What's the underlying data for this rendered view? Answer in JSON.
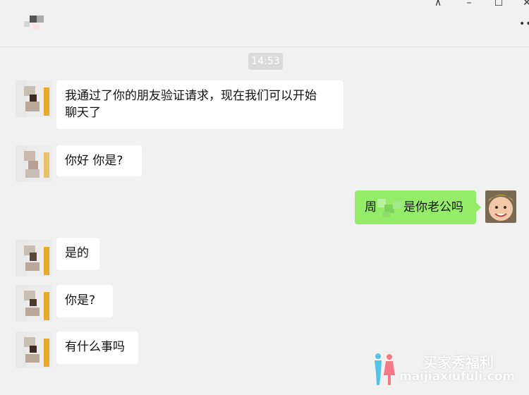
{
  "window": {
    "controls": {
      "pin_icon": "⊼",
      "minimize_icon": "–",
      "maximize_icon": "☐",
      "close_icon": "✕",
      "more_icon": "•••"
    }
  },
  "chat": {
    "timestamp": "14:53",
    "messages": [
      {
        "sender": "other",
        "text": "我通过了你的朋友验证请求，现在我们可以开始\n聊天了"
      },
      {
        "sender": "other",
        "text": "你好 你是?"
      },
      {
        "sender": "me",
        "text_prefix": "周",
        "text_suffix": "是你老公吗"
      },
      {
        "sender": "other",
        "text": "是的"
      },
      {
        "sender": "other",
        "text": "你是?"
      },
      {
        "sender": "other",
        "text": "有什么事吗"
      }
    ]
  },
  "watermark": {
    "line1": "买家秀福利",
    "line2": "maijiaxiufuli.com"
  },
  "colors": {
    "background": "#f1f1f1",
    "my_bubble": "#95ec69",
    "other_bubble": "#ffffff",
    "timestamp_bg": "#dadada"
  }
}
